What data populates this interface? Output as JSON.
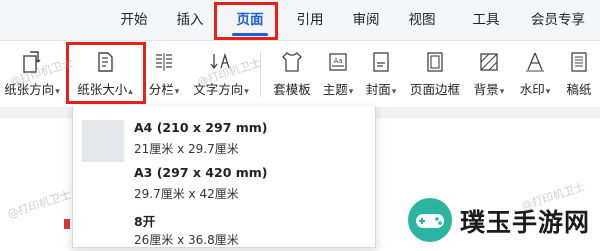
{
  "tabs": [
    {
      "label": "开始"
    },
    {
      "label": "插入"
    },
    {
      "label": "页面"
    },
    {
      "label": "引用"
    },
    {
      "label": "审阅"
    },
    {
      "label": "视图"
    },
    {
      "label": "工具"
    },
    {
      "label": "会员专享"
    }
  ],
  "active_tab": "页面",
  "ribbon": {
    "orientation": {
      "label": "纸张方向",
      "icon": "page-orientation-icon"
    },
    "size": {
      "label": "纸张大小",
      "icon": "page-size-icon"
    },
    "columns": {
      "label": "分栏",
      "icon": "columns-icon"
    },
    "text_direction": {
      "label": "文字方向",
      "icon": "text-direction-icon"
    },
    "template": {
      "label": "套模板",
      "icon": "template-icon"
    },
    "theme": {
      "label": "主题",
      "icon": "theme-icon"
    },
    "cover": {
      "label": "封面",
      "icon": "cover-icon"
    },
    "page_border": {
      "label": "页面边框",
      "icon": "page-border-icon"
    },
    "background": {
      "label": "背景",
      "icon": "background-icon"
    },
    "watermark": {
      "label": "水印",
      "icon": "watermark-icon"
    },
    "manuscript": {
      "label": "稿纸",
      "icon": "manuscript-icon"
    }
  },
  "paper_sizes": [
    {
      "name": "A4 (210 x 297 mm)",
      "dims": "21厘米  x  29.7厘米"
    },
    {
      "name": "A3 (297 x 420 mm)",
      "dims": "29.7厘米  x  42厘米"
    },
    {
      "name": "8开",
      "dims": "26厘米  x  36.8厘米"
    }
  ],
  "watermark_text": "@打印机卫士",
  "site_name": "璞玉手游网",
  "colors": {
    "accent": "#1f5fd6",
    "highlight": "#e8201a",
    "logo": "#2bb5a0"
  }
}
